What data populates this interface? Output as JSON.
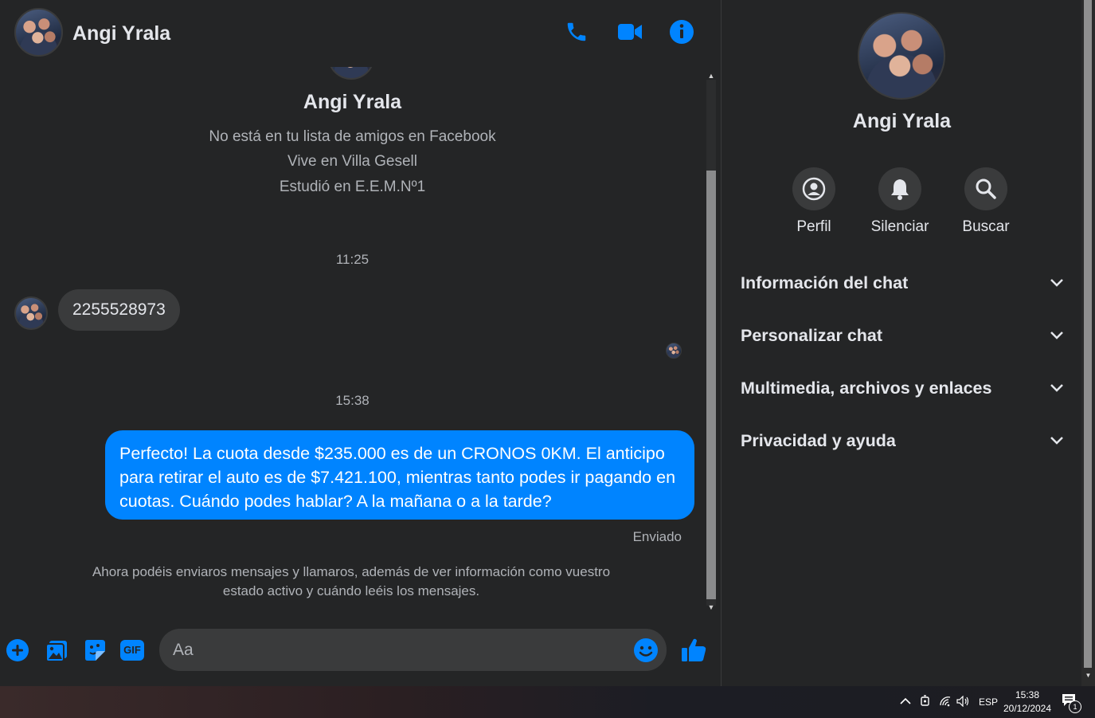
{
  "header": {
    "contact_name": "Angi Yrala"
  },
  "intro": {
    "name": "Angi Yrala",
    "lines": [
      "No está en tu lista de amigos en Facebook",
      "Vive en Villa Gesell",
      "Estudió en E.E.M.Nº1"
    ]
  },
  "messages": {
    "time1": "11:25",
    "incoming_text": "2255528973",
    "time2": "15:38",
    "outgoing_text": "Perfecto! La cuota desde $235.000 es de un CRONOS 0KM. El anticipo para retirar el auto es de $7.421.100, mientras tanto podes ir pagando en cuotas. Cuándo podes hablar? A la mañana o a la tarde?",
    "status": "Enviado",
    "notice": "Ahora podéis enviaros mensajes y llamaros, además de ver información como vuestro estado activo y cuándo leéis los mensajes."
  },
  "composer": {
    "placeholder": "Aa",
    "gif_label": "GIF"
  },
  "panel": {
    "name": "Angi Yrala",
    "actions": [
      {
        "label": "Perfil",
        "icon": "profile-icon"
      },
      {
        "label": "Silenciar",
        "icon": "bell-icon"
      },
      {
        "label": "Buscar",
        "icon": "search-icon"
      }
    ],
    "sections": [
      "Información del chat",
      "Personalizar chat",
      "Multimedia, archivos y enlaces",
      "Privacidad y ayuda"
    ]
  },
  "taskbar": {
    "language": "ESP",
    "time": "15:38",
    "date": "20/12/2024",
    "notification_count": "1"
  },
  "colors": {
    "accent": "#0084ff",
    "background": "#242526",
    "bubble_in": "#3a3b3c"
  }
}
